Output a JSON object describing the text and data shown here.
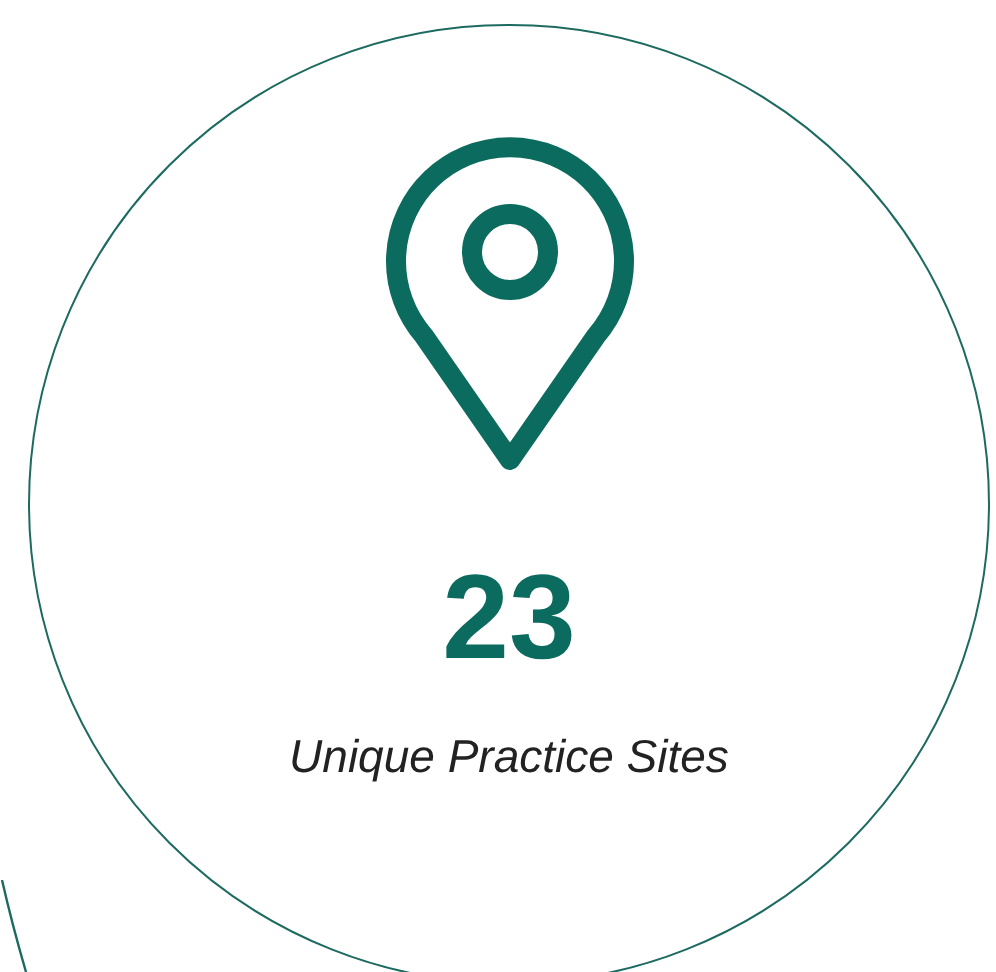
{
  "stat": {
    "value": "23",
    "label": "Unique Practice Sites"
  }
}
